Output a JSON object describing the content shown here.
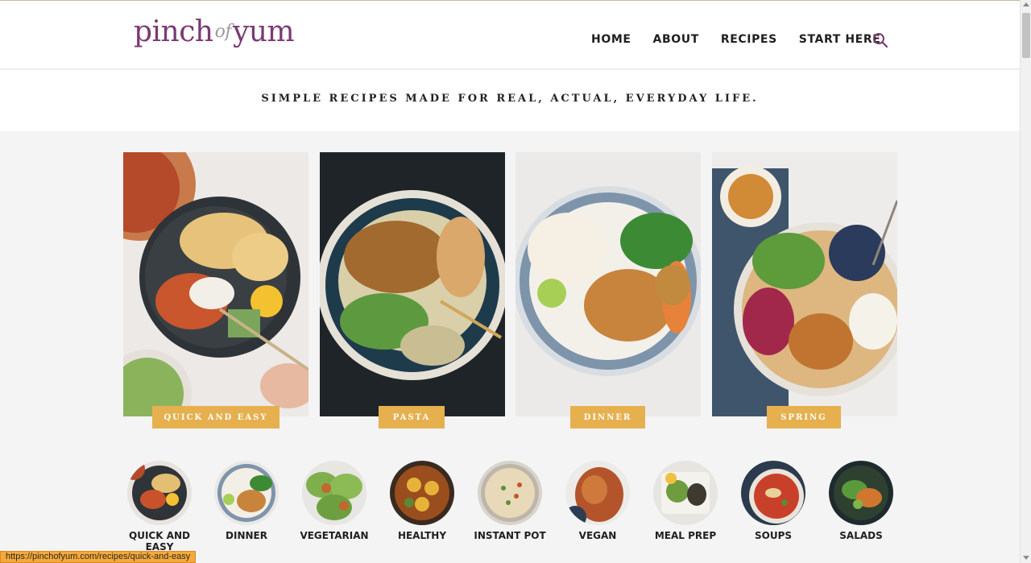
{
  "site": {
    "logo_main": "pinch",
    "logo_of": "of",
    "logo_end": "yum"
  },
  "nav": {
    "items": [
      "HOME",
      "ABOUT",
      "RECIPES",
      "START HERE"
    ]
  },
  "icons": {
    "search": "search-icon"
  },
  "colors": {
    "brand": "#7a3a74",
    "label_bg": "#e6b04f",
    "background": "#f4f4f4"
  },
  "tagline": "SIMPLE RECIPES MADE FOR REAL, ACTUAL, EVERYDAY LIFE.",
  "features": [
    {
      "label": "QUICK AND EASY"
    },
    {
      "label": "PASTA"
    },
    {
      "label": "DINNER"
    },
    {
      "label": "SPRING"
    }
  ],
  "categories": [
    {
      "label": "QUICK AND EASY"
    },
    {
      "label": "DINNER"
    },
    {
      "label": "VEGETARIAN"
    },
    {
      "label": "HEALTHY"
    },
    {
      "label": "INSTANT POT"
    },
    {
      "label": "VEGAN"
    },
    {
      "label": "MEAL PREP"
    },
    {
      "label": "SOUPS"
    },
    {
      "label": "SALADS"
    }
  ],
  "status_bar": {
    "url": "https://pinchofyum.com/recipes/quick-and-easy"
  }
}
